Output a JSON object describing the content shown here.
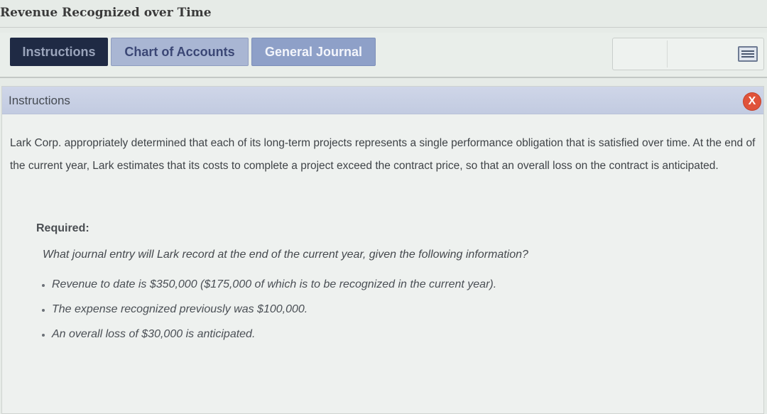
{
  "app": {
    "title": "Revenue Recognized over Time"
  },
  "tabs": [
    {
      "label": "Instructions",
      "active": true
    },
    {
      "label": "Chart of Accounts",
      "active": false
    },
    {
      "label": "General Journal",
      "active": false
    }
  ],
  "toolbar": {
    "menu_icon": "hamburger-menu-icon"
  },
  "panel": {
    "title": "Instructions",
    "close_label": "X",
    "body": "Lark Corp. appropriately determined that each of its long-term projects represents a single performance obligation that is satisfied over time. At the end of the current year, Lark estimates that its costs to complete a project exceed the contract price, so that an overall loss on the contract is anticipated.",
    "required_label": "Required:",
    "question": "What journal entry will Lark record at the end of the current year, given the following information?",
    "bullets": [
      "Revenue to date is $350,000 ($175,000 of which is to be recognized in the current year).",
      "The expense recognized previously was $100,000.",
      "An overall loss of $30,000 is anticipated."
    ]
  },
  "colors": {
    "active_tab": "#1f2a44",
    "inactive_tab": "#a9b6d3",
    "journal_tab": "#8ea0c8",
    "close_button": "#e0533a"
  }
}
